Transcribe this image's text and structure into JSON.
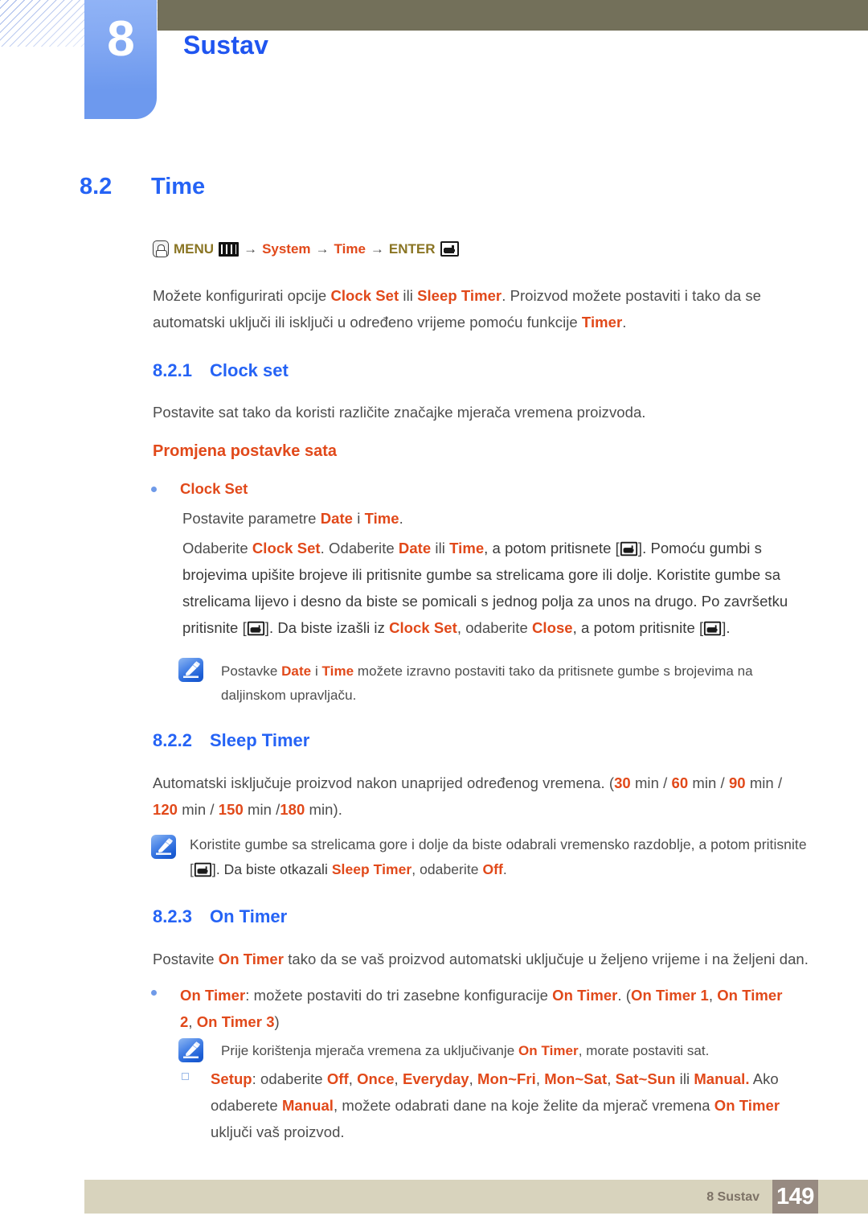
{
  "header": {
    "chapter_number": "8",
    "chapter_title": "Sustav",
    "accent_blue": "#2563f5",
    "accent_red": "#e1491a",
    "tab_blue": "#7ba5f2",
    "olive_bar": "#73705a"
  },
  "section": {
    "number": "8.2",
    "title": "Time"
  },
  "menu_path": {
    "hand_icon": "press-button-icon",
    "menu_label": "MENU",
    "menu_icon": "menu-bars-icon",
    "arrow1": "→",
    "item1": "System",
    "arrow2": "→",
    "item2": "Time",
    "arrow3": "→",
    "enter_label": "ENTER",
    "enter_icon": "enter-key-icon"
  },
  "intro": {
    "t1": "Možete konfigurirati opcije ",
    "b1": "Clock Set",
    "t2": " ili ",
    "b2": "Sleep Timer",
    "t3": ". Proizvod možete postaviti i tako da se automatski uključi ili isključi u određeno vrijeme pomoću funkcije ",
    "b3": "Timer",
    "t4": "."
  },
  "sub_8_2_1": {
    "number": "8.2.1",
    "title": "Clock set",
    "intro": "Postavite sat tako da koristi različite značajke mjerača vremena proizvoda.",
    "heading": "Promjena postavke sata",
    "bullet_label": "Clock Set",
    "line1": {
      "t1": "Postavite parametre ",
      "b1": "Date",
      "t2": " i ",
      "b2": "Time",
      "t3": "."
    },
    "line2": {
      "t1": "Odaberite ",
      "b1": "Clock Set",
      "t2": ". Odaberite ",
      "b2": "Date",
      "t3": " ili ",
      "b3": "Time",
      "t4": ", a potom pritisnete [",
      "t5": "]. Pomoću gumbi s brojevima upišite brojeve ili pritisnite gumbe sa strelicama gore ili dolje. Koristite gumbe sa strelicama lijevo i desno da biste se pomicali s jednog polja za unos na drugo. Po završetku pritisnite [",
      "t6": "]. Da biste izašli iz ",
      "b4": "Clock Set",
      "t7": ", odaberite ",
      "b5": "Close",
      "t8": ", a potom pritisnite [",
      "t9": "]."
    },
    "note": {
      "icon": "note-pencil-icon",
      "t1": "Postavke ",
      "b1": "Date",
      "t2": " i ",
      "b2": "Time",
      "t3": " možete izravno postaviti tako da pritisnete gumbe s brojevima na daljinskom upravljaču."
    }
  },
  "sub_8_2_2": {
    "number": "8.2.2",
    "title": "Sleep Timer",
    "body": {
      "t1": "Automatski isključuje proizvod nakon unaprijed određenog vremena. (",
      "v1": "30",
      "t2": " min / ",
      "v2": "60",
      "t3": " min / ",
      "v3": "90",
      "t4": " min / ",
      "v4": "120",
      "t5": " min / ",
      "v5": "150",
      "t6": " min /",
      "v6": "180",
      "t7": " min)."
    },
    "note": {
      "icon": "note-pencil-icon",
      "t1": "Koristite gumbe sa strelicama gore i dolje da biste odabrali vremensko razdoblje, a potom pritisnite [",
      "t2": "]. Da biste otkazali ",
      "b1": "Sleep Timer",
      "t3": ", odaberite ",
      "b2": "Off",
      "t4": "."
    }
  },
  "sub_8_2_3": {
    "number": "8.2.3",
    "title": "On Timer",
    "intro": {
      "t1": "Postavite ",
      "b1": "On Timer",
      "t2": " tako da se vaš proizvod automatski uključuje u željeno vrijeme i na željeni dan."
    },
    "bullet1": {
      "b1": "On Timer",
      "t1": ": možete postaviti do tri zasebne konfiguracije ",
      "b2": "On Timer",
      "t2": ". (",
      "b3": "On Timer 1",
      "t3": ", ",
      "b4": "On Timer 2",
      "t4": ", ",
      "b5": "On Timer 3",
      "t5": ")"
    },
    "note": {
      "icon": "note-pencil-icon",
      "t1": "Prije korištenja mjerača vremena za uključivanje ",
      "b1": "On Timer",
      "t2": ", morate postaviti sat."
    },
    "bullet2": {
      "b1": "Setup",
      "t1": ": odaberite ",
      "b2": "Off",
      "t2": ", ",
      "b3": "Once",
      "t3": ", ",
      "b4": "Everyday",
      "t4": ", ",
      "b5": "Mon~Fri",
      "t5": ", ",
      "b6": "Mon~Sat",
      "t6": ", ",
      "b7": "Sat~Sun",
      "t7": " ili ",
      "b8": "Manual.",
      "t8": " Ako odaberete ",
      "b9": "Manual",
      "t9": ", možete odabrati dane na koje želite da mjerač vremena ",
      "b10": "On Timer",
      "t10": " uključi vaš proizvod."
    }
  },
  "footer": {
    "label": "8 Sustav",
    "page": "149",
    "bar_color": "#d8d3bd",
    "page_box_color": "#978a81"
  }
}
